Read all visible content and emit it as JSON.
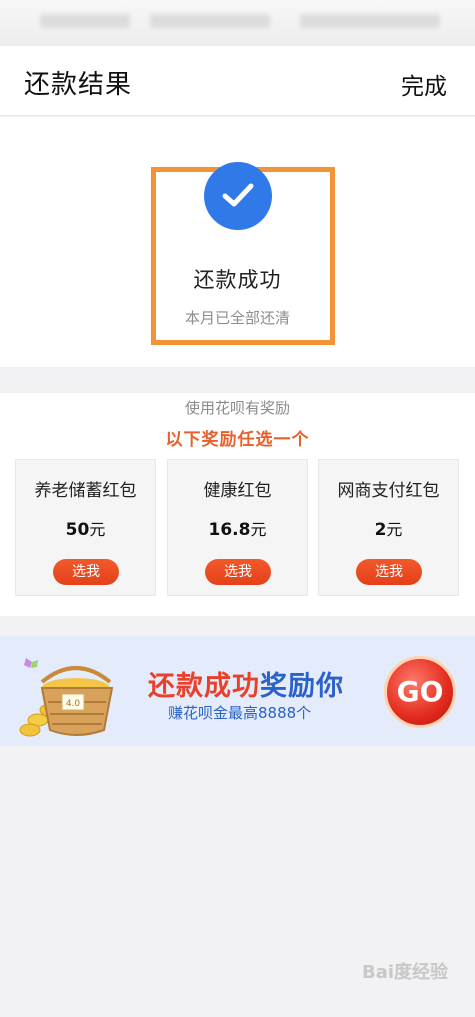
{
  "header": {
    "title": "还款结果",
    "done_label": "完成"
  },
  "result": {
    "status": "还款成功",
    "sub": "本月已全部还清",
    "icon": "check-circle-icon",
    "accent": "#2f79e8",
    "highlight_color": "#f29335"
  },
  "rewards": {
    "hint": "使用花呗有奖励",
    "pick": "以下奖励任选一个",
    "cards": [
      {
        "name": "养老储蓄红包",
        "amount": "50",
        "unit": "元",
        "button": "选我"
      },
      {
        "name": "健康红包",
        "amount": "16.8",
        "unit": "元",
        "button": "选我"
      },
      {
        "name": "网商支付红包",
        "amount": "2",
        "unit": "元",
        "button": "选我"
      }
    ]
  },
  "banner": {
    "headline_red": "还款成功",
    "headline_blue": "奖励你",
    "subline": "赚花呗金最高8888个",
    "go_label": "GO",
    "basket_label": "4.0",
    "basket_icon": "gold-coin-basket-icon"
  },
  "watermark": "Bai度经验"
}
